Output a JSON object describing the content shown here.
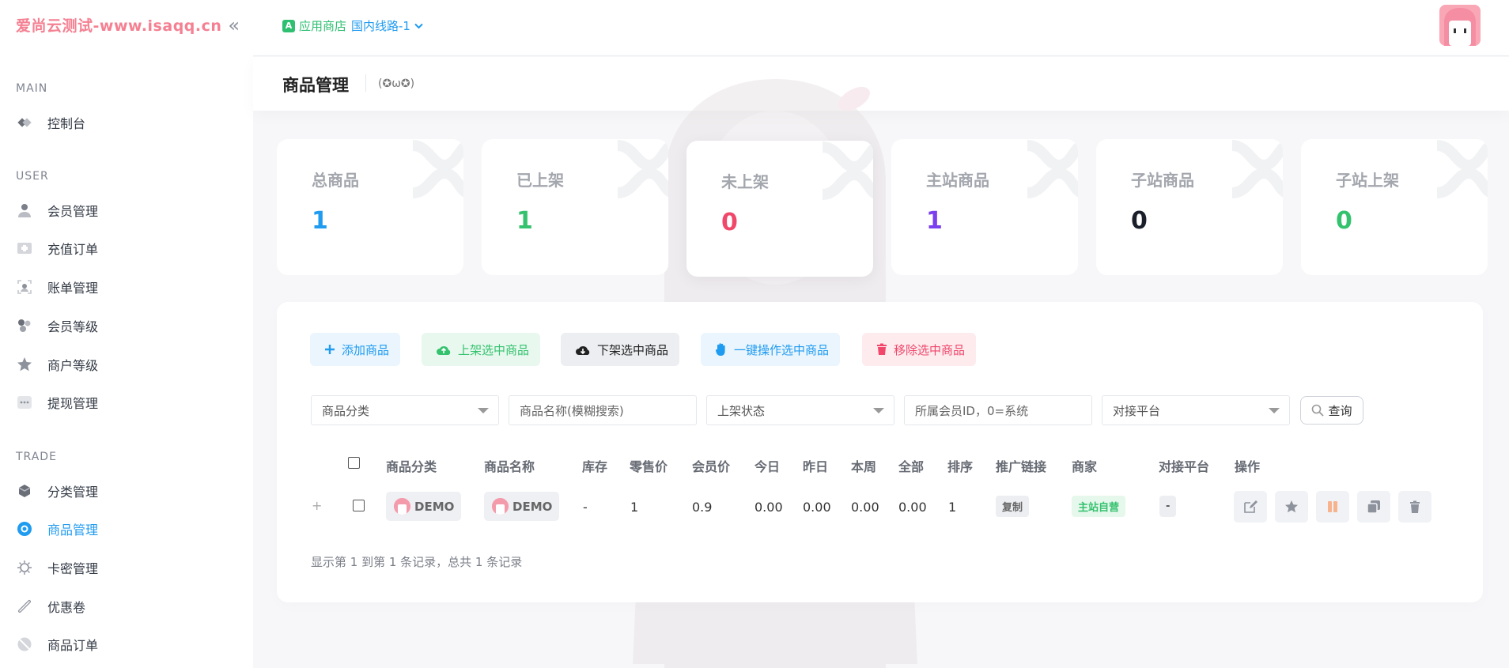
{
  "brand": {
    "text": "爱尚云测试-www.isaqq.cn"
  },
  "sidebar": {
    "groups": [
      {
        "title": "MAIN",
        "items": [
          {
            "label": "控制台",
            "icon": "dashboard-icon"
          }
        ]
      },
      {
        "title": "USER",
        "items": [
          {
            "label": "会员管理",
            "icon": "user-icon"
          },
          {
            "label": "充值订单",
            "icon": "recharge-icon"
          },
          {
            "label": "账单管理",
            "icon": "bill-icon"
          },
          {
            "label": "会员等级",
            "icon": "level-icon"
          },
          {
            "label": "商户等级",
            "icon": "star-icon"
          },
          {
            "label": "提现管理",
            "icon": "withdraw-icon"
          }
        ]
      },
      {
        "title": "TRADE",
        "items": [
          {
            "label": "分类管理",
            "icon": "category-icon"
          },
          {
            "label": "商品管理",
            "icon": "goods-icon",
            "active": true
          },
          {
            "label": "卡密管理",
            "icon": "card-key-icon"
          },
          {
            "label": "优惠卷",
            "icon": "coupon-icon"
          },
          {
            "label": "商品订单",
            "icon": "order-icon"
          }
        ]
      }
    ]
  },
  "header": {
    "store_label": "应用商店",
    "route_label": "国内线路-1"
  },
  "page": {
    "title": "商品管理",
    "kaomoji": "(✪ω✪)"
  },
  "stats": [
    {
      "label": "总商品",
      "value": "1",
      "color": "#1f9bf0"
    },
    {
      "label": "已上架",
      "value": "1",
      "color": "#34c26e"
    },
    {
      "label": "未上架",
      "value": "0",
      "color": "#f0476a"
    },
    {
      "label": "主站商品",
      "value": "1",
      "color": "#7b3ff0"
    },
    {
      "label": "子站商品",
      "value": "0",
      "color": "#1a1f2b"
    },
    {
      "label": "子站上架",
      "value": "0",
      "color": "#34c26e"
    }
  ],
  "toolbar": {
    "add": "添加商品",
    "list_on": "上架选中商品",
    "list_off": "下架选中商品",
    "batch_op": "一键操作选中商品",
    "remove": "移除选中商品"
  },
  "filters": {
    "category": "商品分类",
    "name_placeholder": "商品名称(模糊搜索)",
    "status": "上架状态",
    "member_placeholder": "所属会员ID，0=系统",
    "platform": "对接平台",
    "search_label": "查询"
  },
  "table": {
    "columns": [
      "商品分类",
      "商品名称",
      "库存",
      "零售价",
      "会员价",
      "今日",
      "昨日",
      "本周",
      "全部",
      "排序",
      "推广链接",
      "商家",
      "对接平台",
      "操作"
    ],
    "rows": [
      {
        "expand": "+",
        "category": "DEMO",
        "name": "DEMO",
        "stock": "-",
        "retail_price": "1",
        "member_price": "0.9",
        "today": "0.00",
        "yesterday": "0.00",
        "week": "0.00",
        "total": "0.00",
        "sort": "1",
        "promo": "复制",
        "merchant": "主站自营",
        "platform": "-"
      }
    ],
    "footer": "显示第 1 到第 1 条记录，总共 1 条记录"
  },
  "colors": {
    "accent": "#1f9bf0",
    "green": "#34c26e",
    "red": "#f0476a",
    "purple": "#7b3ff0",
    "pink": "#f36b7f"
  }
}
